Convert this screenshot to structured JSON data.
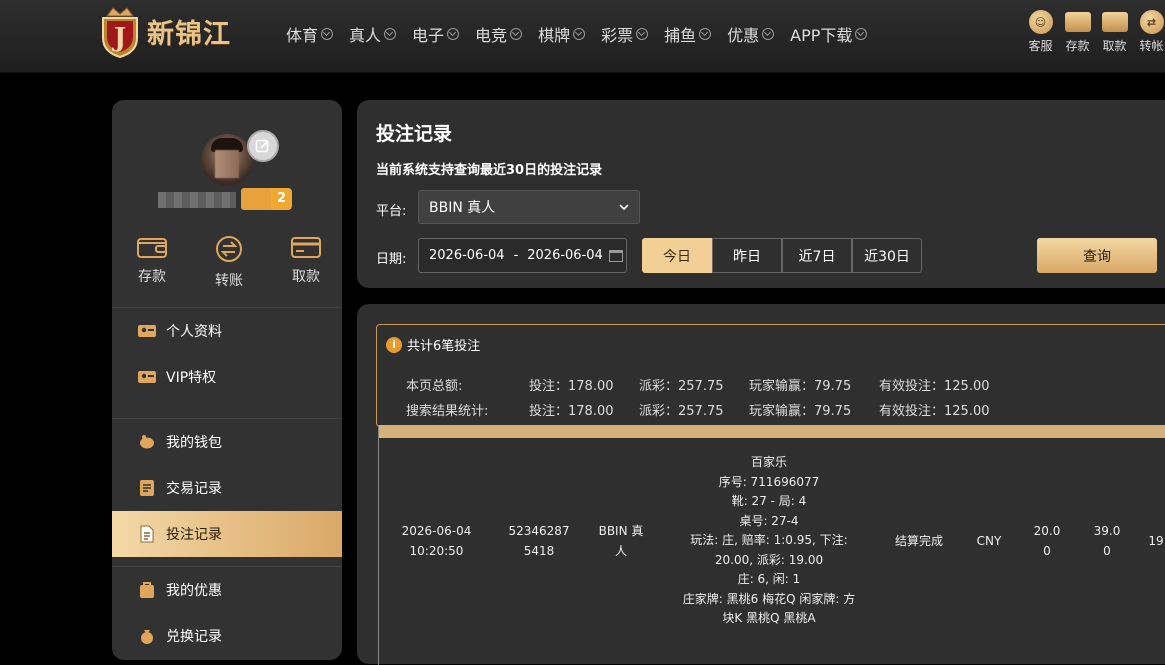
{
  "brand": {
    "name": "新锦江"
  },
  "nav": [
    {
      "label": "体育"
    },
    {
      "label": "真人"
    },
    {
      "label": "电子"
    },
    {
      "label": "电竞"
    },
    {
      "label": "棋牌"
    },
    {
      "label": "彩票"
    },
    {
      "label": "捕鱼"
    },
    {
      "label": "优惠"
    },
    {
      "label": "APP下载"
    }
  ],
  "quick_actions": [
    {
      "label": "客服",
      "icon": "service-icon"
    },
    {
      "label": "存款",
      "icon": "deposit-wallet-icon"
    },
    {
      "label": "取款",
      "icon": "withdraw-card-icon"
    },
    {
      "label": "转帐",
      "icon": "transfer-icon"
    }
  ],
  "profile": {
    "vip_level": "2"
  },
  "wallet_actions": [
    {
      "label": "存款"
    },
    {
      "label": "转账"
    },
    {
      "label": "取款"
    }
  ],
  "side_menu": {
    "group1": [
      {
        "label": "个人资料"
      },
      {
        "label": "VIP特权"
      }
    ],
    "group2": [
      {
        "label": "我的钱包"
      },
      {
        "label": "交易记录"
      },
      {
        "label": "投注记录"
      }
    ],
    "group3": [
      {
        "label": "我的优惠"
      },
      {
        "label": "兑换记录"
      }
    ]
  },
  "page": {
    "title": "投注记录",
    "subtitle": "当前系统支持查询最近30日的投注记录",
    "platform_label": "平台:",
    "platform_value": "BBIN 真人",
    "date_label": "日期:",
    "date_from": "2026-06-04",
    "date_sep": "-",
    "date_to": "2026-06-04",
    "ranges": [
      {
        "label": "今日"
      },
      {
        "label": "昨日"
      },
      {
        "label": "近7日"
      },
      {
        "label": "近30日"
      }
    ],
    "query_label": "查询"
  },
  "summary": {
    "total_text": "共计6笔投注",
    "page_total_label": "本页总额:",
    "search_total_label": "搜索结果统计:",
    "page_totals": {
      "bet": "投注：178.00",
      "payout": "派彩：257.75",
      "winloss": "玩家输赢：79.75",
      "valid": "有效投注：125.00"
    },
    "search_totals": {
      "bet": "投注：178.00",
      "payout": "派彩：257.75",
      "winloss": "玩家输赢：79.75",
      "valid": "有效投注：125.00"
    }
  },
  "bet_rows": [
    {
      "time": "2026-06-04\n10:20:50",
      "order_no": "52346287\n5418",
      "platform": "BBIN 真\n人",
      "detail": "百家乐\n序号: 711696077\n靴: 27 - 局: 4\n桌号: 27-4\n玩法: 庄, 赔率: 1:0.95, 下注:\n20.00, 派彩: 19.00\n庄: 6, 闲: 1\n庄家牌: 黑桃6 梅花Q 闲家牌: 方\n块K 黑桃Q 黑桃A",
      "status": "结算完成",
      "currency": "CNY",
      "bet": "20.0\n0",
      "payout": "39.0\n0",
      "extra": "19"
    }
  ]
}
